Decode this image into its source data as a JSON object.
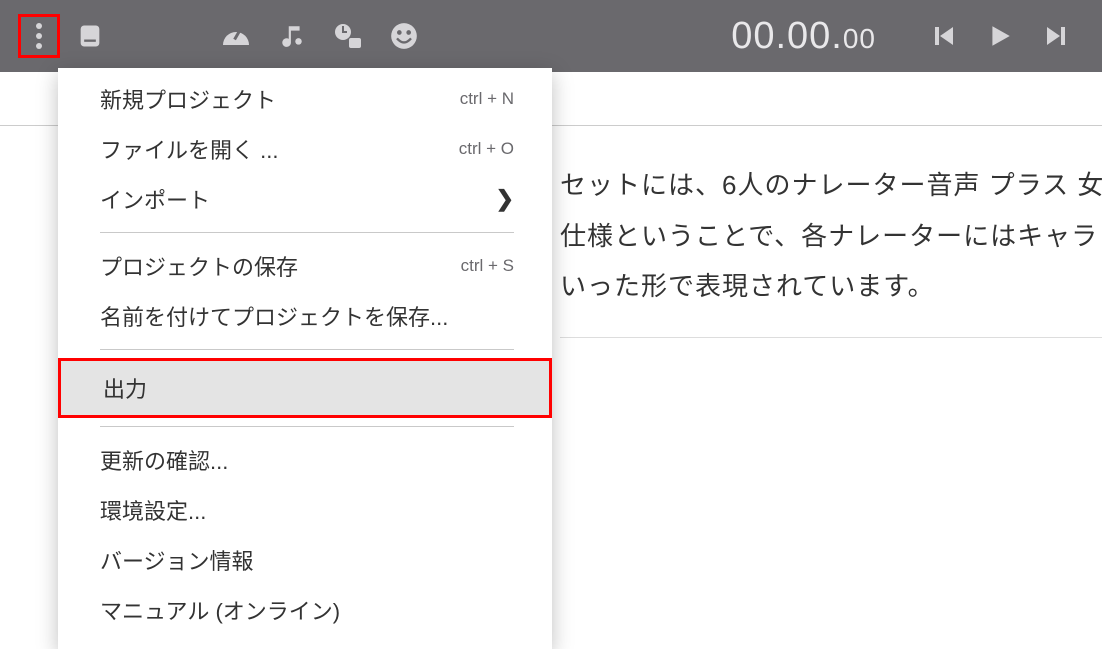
{
  "toolbar": {
    "time_major": "00.00.",
    "time_minor": "00"
  },
  "menu": {
    "new_project": "新規プロジェクト",
    "new_project_sc": "ctrl + N",
    "open_file": "ファイルを開く ...",
    "open_file_sc": "ctrl + O",
    "import": "インポート",
    "save_project": "プロジェクトの保存",
    "save_project_sc": "ctrl + S",
    "save_as": "名前を付けてプロジェクトを保存...",
    "export": "出力",
    "check_update": "更新の確認...",
    "preferences": "環境設定...",
    "version": "バージョン情報",
    "manual": "マニュアル (オンライン)"
  },
  "body": {
    "line1": "セットには、6人のナレーター音声 プラス 女",
    "line2": "仕様ということで、各ナレーターにはキャラ",
    "line3": "いった形で表現されています。"
  }
}
